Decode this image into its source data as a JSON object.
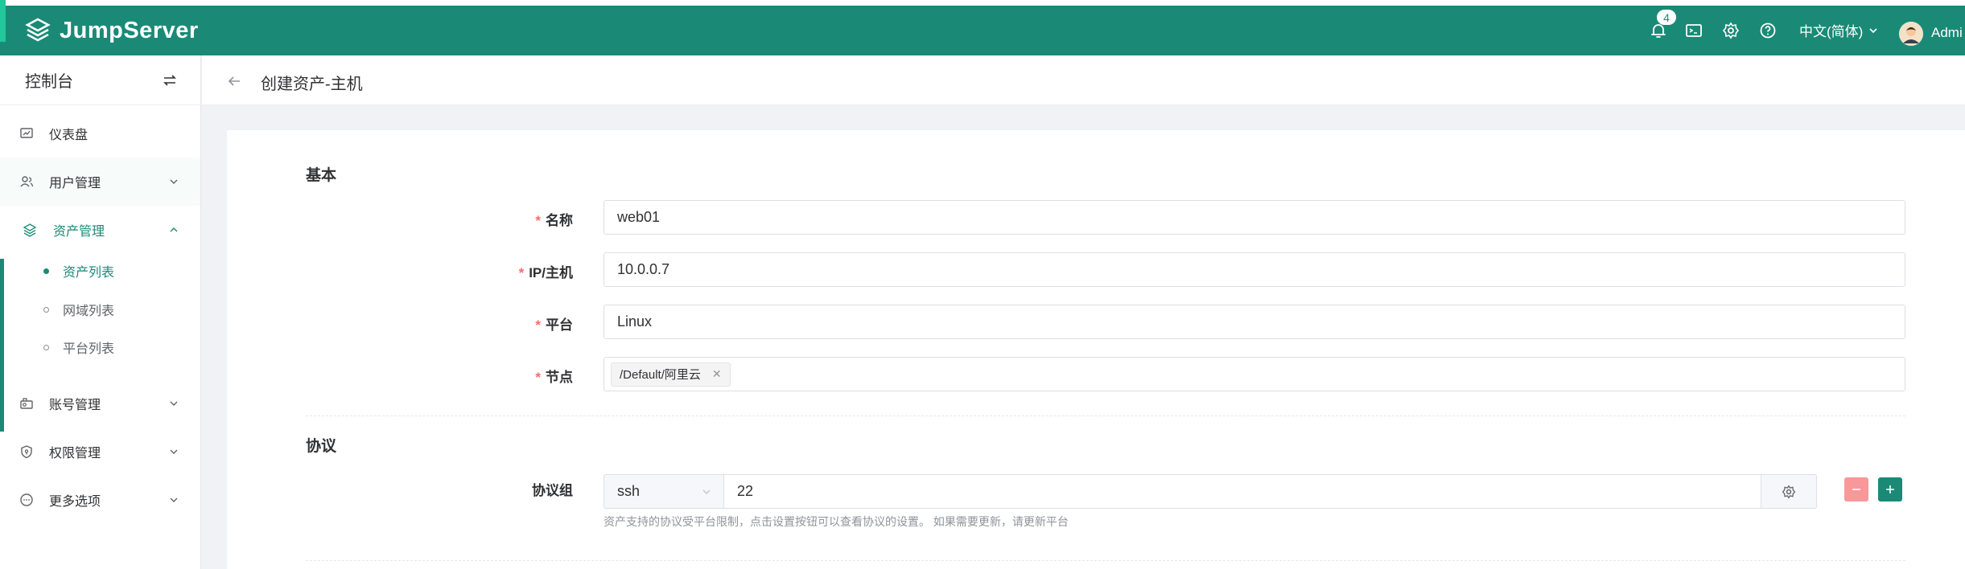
{
  "app": {
    "logo_text": "JumpServer"
  },
  "topbar": {
    "notification_count": "4",
    "language": "中文(简体)",
    "user_name": "Admi"
  },
  "sidebar": {
    "title": "控制台",
    "items": [
      {
        "label": "仪表盘",
        "icon": "dashboard-icon"
      },
      {
        "label": "用户管理",
        "icon": "users-icon"
      },
      {
        "label": "资产管理",
        "icon": "assets-icon"
      },
      {
        "label": "账号管理",
        "icon": "accounts-icon"
      },
      {
        "label": "权限管理",
        "icon": "perms-icon"
      },
      {
        "label": "更多选项",
        "icon": "more-icon"
      }
    ],
    "sub_items": [
      {
        "label": "资产列表"
      },
      {
        "label": "网域列表"
      },
      {
        "label": "平台列表"
      }
    ]
  },
  "page": {
    "title": "创建资产-主机"
  },
  "form": {
    "basic_title": "基本",
    "name_label": "名称",
    "name_value": "web01",
    "ip_label": "IP/主机",
    "ip_value": "10.0.0.7",
    "platform_label": "平台",
    "platform_value": "Linux",
    "node_label": "节点",
    "node_tag": "/Default/阿里云",
    "required_mark": "*",
    "protocol_title": "协议",
    "protocol_group_label": "协议组",
    "protocol_name": "ssh",
    "protocol_port": "22",
    "protocol_help": "资产支持的协议受平台限制，点击设置按钮可以查看协议的设置。 如果需要更新，请更新平台"
  },
  "colors": {
    "brand": "#1a8a77",
    "required": "#f56c6c",
    "danger_light": "#f89898"
  }
}
